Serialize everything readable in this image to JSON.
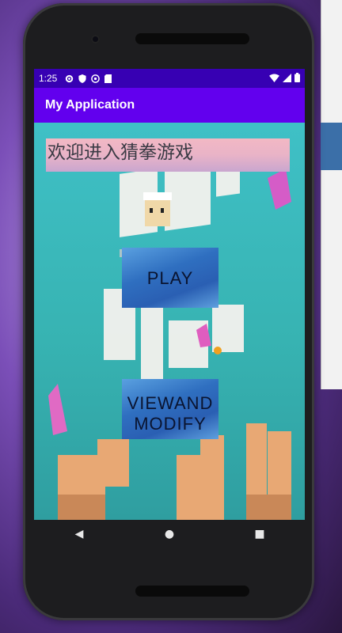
{
  "status_bar": {
    "time": "1:25"
  },
  "app_bar": {
    "title": "My Application"
  },
  "main": {
    "welcome_text": "欢迎进入猜拳游戏",
    "play_button": "PLAY",
    "view_button": "VIEWAND MODIFY"
  },
  "nav": {
    "back": "◀",
    "home": "●",
    "recents": "■"
  },
  "colors": {
    "status_bar": "#3700b3",
    "app_bar": "#6200ee",
    "background": "#36b6b0"
  },
  "icons": [
    "gear-icon",
    "shield-icon",
    "sync-icon",
    "sd-card-icon",
    "wifi-icon",
    "signal-icon",
    "battery-icon"
  ]
}
